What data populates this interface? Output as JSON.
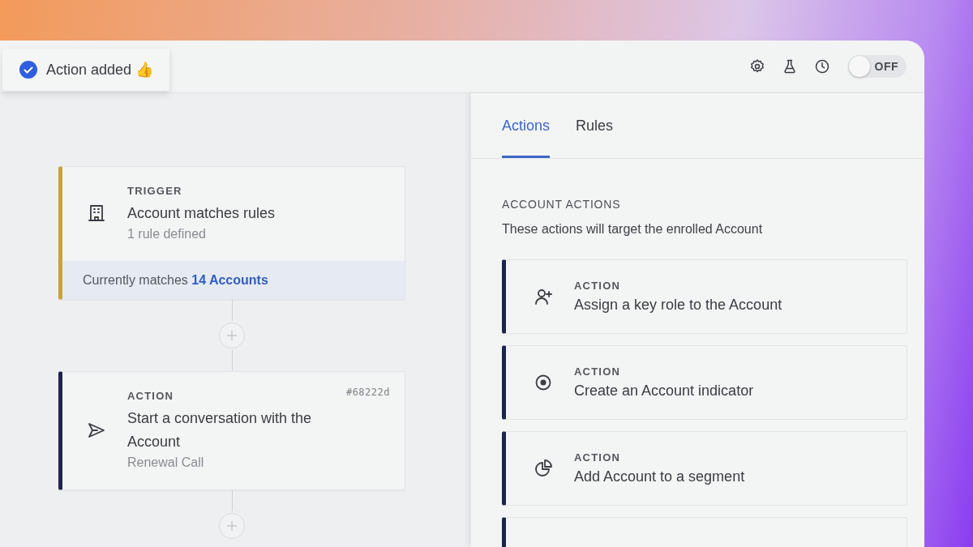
{
  "toast": {
    "text": "Action added 👍"
  },
  "header": {
    "toggle": {
      "label": "OFF",
      "on": false
    }
  },
  "flow": {
    "nodes": [
      {
        "kind": "trigger",
        "label": "TRIGGER",
        "title": "Account matches rules",
        "subtitle": "1 rule defined",
        "footer": {
          "text": "Currently matches ",
          "link": "14 Accounts"
        }
      },
      {
        "kind": "action",
        "label": "ACTION",
        "title": "Start a conversation with the Account",
        "subtitle": "Renewal Call",
        "code": "#68222d"
      }
    ]
  },
  "panel": {
    "tabs": [
      {
        "label": "Actions",
        "selected": true
      },
      {
        "label": "Rules",
        "selected": false
      }
    ],
    "section": {
      "heading": "ACCOUNT ACTIONS",
      "description": "These actions will target the enrolled Account"
    },
    "actions": [
      {
        "kind": "action",
        "label": "ACTION",
        "title": "Assign a key role to the Account"
      },
      {
        "kind": "action",
        "label": "ACTION",
        "title": "Create an Account indicator"
      },
      {
        "kind": "action",
        "label": "ACTION",
        "title": "Add Account to a segment"
      },
      {
        "kind": "action"
      }
    ]
  }
}
